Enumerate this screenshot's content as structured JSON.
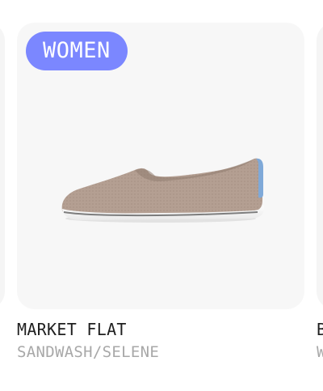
{
  "product": {
    "category_badge": "WOMEN",
    "name": "MARKET FLAT",
    "colorway": "SANDWASH/SELENE",
    "image_icon": "shoe-product-image"
  },
  "next_product": {
    "name_fragment": "B",
    "colorway_fragment": "W"
  },
  "colors": {
    "badge_background": "#7b87ff",
    "badge_text": "#ffffff",
    "tile_background": "#f7f7f7",
    "name_text": "#1f1f1f",
    "colorway_text": "#a8a8a8",
    "shoe_upper": "#b39f92",
    "shoe_sole": "#ffffff",
    "heel_tab": "#7fa9d8"
  }
}
